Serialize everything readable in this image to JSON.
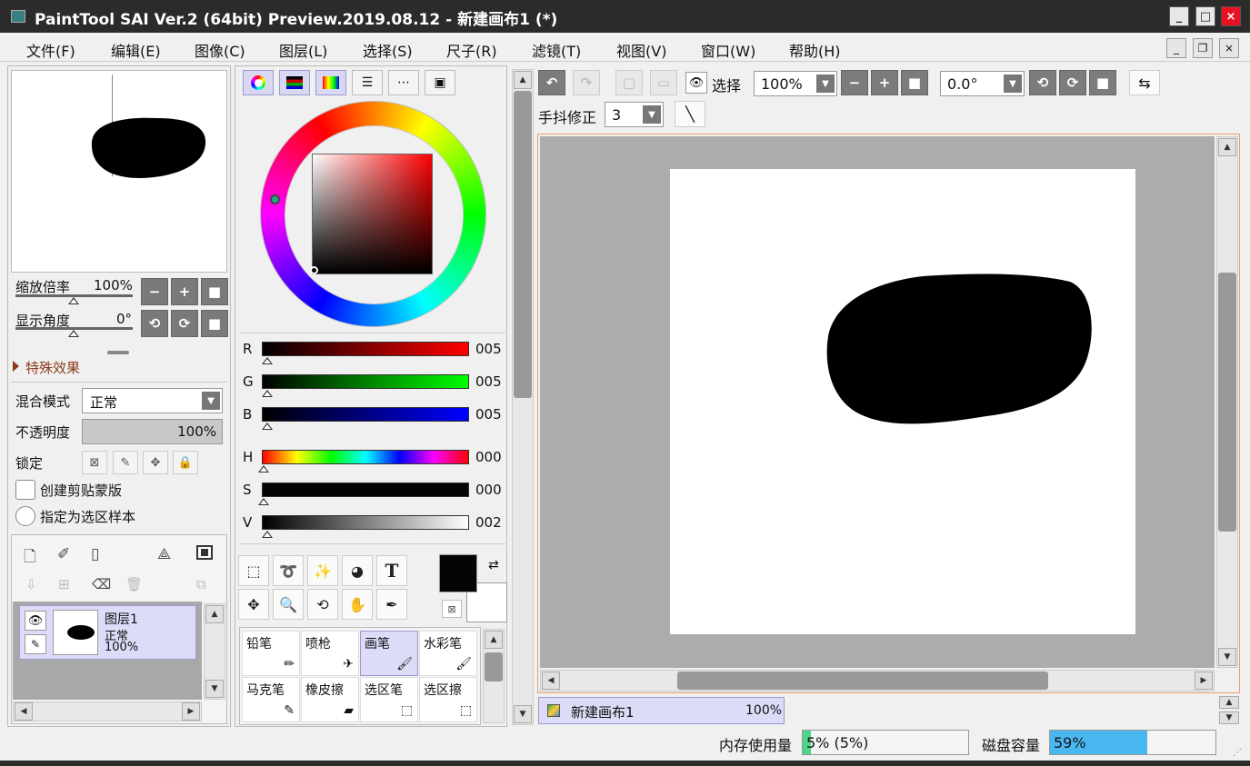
{
  "app": {
    "title": "PaintTool SAI Ver.2 (64bit) Preview.2019.08.12 - 新建画布1 (*)"
  },
  "window_buttons": {
    "minimize": "_",
    "maximize": "□",
    "close": "×"
  },
  "menu": [
    "文件(F)",
    "编辑(E)",
    "图像(C)",
    "图层(L)",
    "选择(S)",
    "尺子(R)",
    "滤镜(T)",
    "视图(V)",
    "窗口(W)",
    "帮助(H)"
  ],
  "navigator": {
    "zoom_label": "缩放倍率",
    "zoom_value": "100%",
    "angle_label": "显示角度",
    "angle_value": "0°"
  },
  "layer_props": {
    "effects_label": "特殊效果",
    "blend_label": "混合模式",
    "blend_value": "正常",
    "opacity_label": "不透明度",
    "opacity_value": "100%",
    "lock_label": "锁定",
    "clip_label": "创建剪贴蒙版",
    "selection_sample_label": "指定为选区样本"
  },
  "layers": [
    {
      "name": "图层1",
      "mode": "正常",
      "opacity": "100%"
    }
  ],
  "color": {
    "sliders": [
      {
        "label": "R",
        "value": "005"
      },
      {
        "label": "G",
        "value": "005"
      },
      {
        "label": "B",
        "value": "005"
      },
      {
        "label": "H",
        "value": "000"
      },
      {
        "label": "S",
        "value": "000"
      },
      {
        "label": "V",
        "value": "002"
      }
    ],
    "primary": "#050505",
    "secondary": "#ffffff"
  },
  "tools": {
    "text_tool": "T"
  },
  "brushes": [
    {
      "name": "铅笔",
      "icon": "pencil-icon"
    },
    {
      "name": "喷枪",
      "icon": "airbrush-icon"
    },
    {
      "name": "画笔",
      "icon": "brush-icon",
      "selected": true
    },
    {
      "name": "水彩笔",
      "icon": "watercolor-icon"
    },
    {
      "name": "马克笔",
      "icon": "marker-icon"
    },
    {
      "name": "橡皮擦",
      "icon": "eraser-icon"
    },
    {
      "name": "选区笔",
      "icon": "selection-pen-icon"
    },
    {
      "name": "选区擦",
      "icon": "selection-eraser-icon"
    }
  ],
  "canvas_toolbar": {
    "select_label": "选择",
    "zoom_value": "100%",
    "angle_value": "0.0°",
    "stabilizer_label": "手抖修正",
    "stabilizer_value": "3"
  },
  "document_tab": {
    "name": "新建画布1",
    "zoom": "100%"
  },
  "status": {
    "memory_label": "内存使用量",
    "memory_value": "5% (5%)",
    "memory_fraction": 0.05,
    "disk_label": "磁盘容量",
    "disk_value": "59%",
    "disk_fraction": 0.59
  }
}
